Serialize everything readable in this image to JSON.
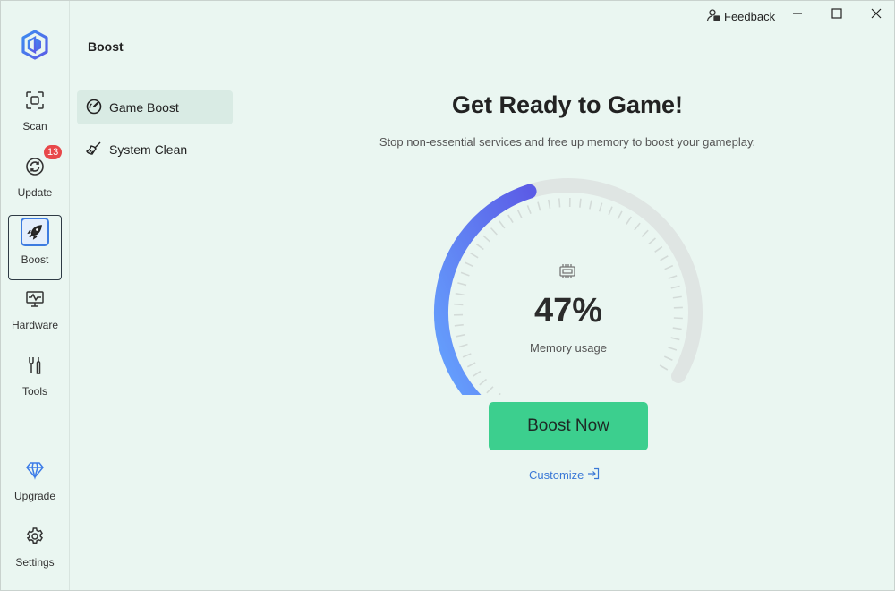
{
  "titlebar": {
    "feedback_label": "Feedback",
    "minimize_icon": "minimize-icon",
    "maximize_icon": "maximize-icon",
    "close_icon": "close-icon"
  },
  "rail": {
    "items": [
      {
        "label": "Scan",
        "icon": "scan-icon"
      },
      {
        "label": "Update",
        "icon": "refresh-icon",
        "badge": "13"
      },
      {
        "label": "Boost",
        "icon": "rocket-icon",
        "active": true
      },
      {
        "label": "Hardware",
        "icon": "monitor-pulse-icon"
      },
      {
        "label": "Tools",
        "icon": "wrench-screwdriver-icon"
      },
      {
        "label": "Upgrade",
        "icon": "diamond-icon"
      },
      {
        "label": "Settings",
        "icon": "gear-icon"
      }
    ]
  },
  "section": {
    "title": "Boost"
  },
  "subnav": {
    "items": [
      {
        "label": "Game Boost",
        "icon": "gauge-icon",
        "active": true
      },
      {
        "label": "System Clean",
        "icon": "broom-icon"
      }
    ]
  },
  "main": {
    "headline": "Get Ready to Game!",
    "subline": "Stop non-essential services and free up memory to boost your gameplay.",
    "memory_percent": "47%",
    "memory_value": 0.47,
    "memory_label": "Memory usage",
    "boost_button": "Boost Now",
    "customize_label": "Customize"
  },
  "colors": {
    "background": "#eaf6f1",
    "accent_green": "#3ccf8e",
    "gauge_start": "#66a6ff",
    "gauge_end": "#5b5ce6",
    "gauge_track": "#dfe5e3",
    "link": "#3a78d6",
    "badge": "#e8484a"
  }
}
